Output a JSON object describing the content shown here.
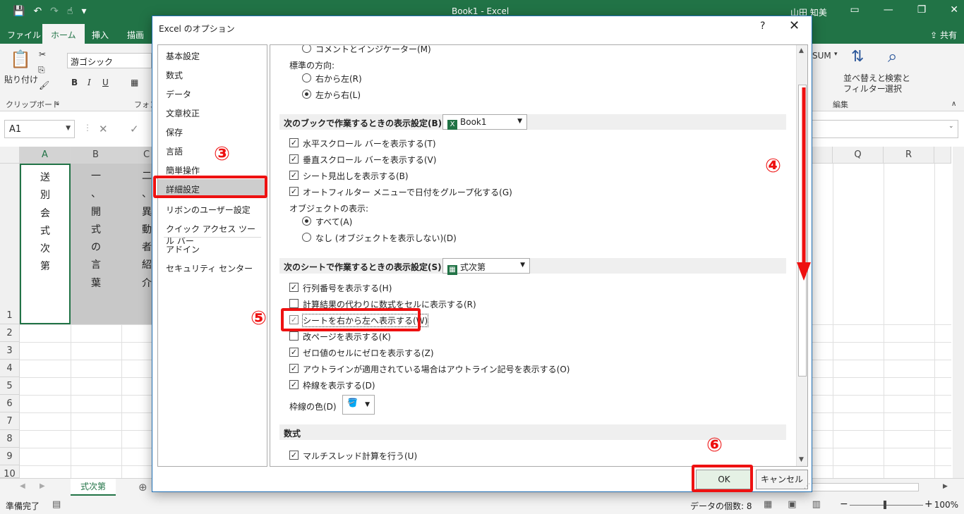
{
  "window": {
    "title": "Book1  -  Excel",
    "user": "山田 知美",
    "share_label": "共有"
  },
  "ribbon": {
    "tabs": [
      "ファイル",
      "ホーム",
      "挿入",
      "描画"
    ],
    "paste_label": "貼り付け",
    "clipboard_group": "クリップボード",
    "font_group": "フォン",
    "font_name": "游ゴシック",
    "bold": "B",
    "italic": "I",
    "underline": "U",
    "sum_label": "SUM",
    "sort_label": "並べ替えと\nフィルター",
    "find_label": "検索と\n選択",
    "edit_group": "編集"
  },
  "formula_bar": {
    "name_box": "A1",
    "cancel": "✕",
    "enter": "✓"
  },
  "grid": {
    "columns": [
      "A",
      "B",
      "C",
      "Q",
      "R"
    ],
    "rows": [
      "1",
      "2",
      "3",
      "4",
      "5",
      "6",
      "7",
      "8",
      "9",
      "10"
    ],
    "col_a_text": [
      "送",
      "別",
      "会",
      "式",
      "次",
      "第"
    ],
    "col_b_text": [
      "一",
      "、",
      "開",
      "式",
      "の",
      "言",
      "葉"
    ],
    "col_c_text": [
      "二",
      "、",
      "異",
      "動",
      "者",
      "紹",
      "介"
    ]
  },
  "sheet_tab": "式次第",
  "status": {
    "ready": "準備完了",
    "count": "データの個数: 8",
    "zoom": "100%"
  },
  "dialog": {
    "title": "Excel のオプション",
    "help": "?",
    "close": "✕",
    "nav": [
      "基本設定",
      "数式",
      "データ",
      "文章校正",
      "保存",
      "言語",
      "簡単操作",
      "詳細設定",
      "リボンのユーザー設定",
      "クイック アクセス ツール バー",
      "アドイン",
      "セキュリティ センター"
    ],
    "top": {
      "comment_indicator": "コメントとインジケーター(M)",
      "direction_label": "標準の方向:",
      "rtl": "右から左(R)",
      "ltr": "左から右(L)"
    },
    "book_section": {
      "title": "次のブックで作業するときの表示設定(B):",
      "combo": "Book1",
      "hscroll": "水平スクロール バーを表示する(T)",
      "vscroll": "垂直スクロール バーを表示する(V)",
      "sheet_tabs": "シート見出しを表示する(B)",
      "autofilter": "オートフィルター メニューで日付をグループ化する(G)",
      "objects_label": "オブジェクトの表示:",
      "all": "すべて(A)",
      "none": "なし (オブジェクトを表示しない)(D)"
    },
    "sheet_section": {
      "title": "次のシートで作業するときの表示設定(S):",
      "combo": "式次第",
      "headers": "行列番号を表示する(H)",
      "formulas": "計算結果の代わりに数式をセルに表示する(R)",
      "rtl_sheet": "シートを右から左へ表示する(W)",
      "page_breaks": "改ページを表示する(K)",
      "zero": "ゼロ値のセルにゼロを表示する(Z)",
      "outline": "アウトラインが適用されている場合はアウトライン記号を表示する(O)",
      "gridlines": "枠線を表示する(D)",
      "grid_color": "枠線の色(D)"
    },
    "formula_section": {
      "title": "数式",
      "multithread": "マルチスレッド計算を行う(U)"
    },
    "ok": "OK",
    "cancel": "キャンセル"
  },
  "annotations": {
    "step3": "③",
    "step4": "④",
    "step5": "⑤",
    "step6": "⑥",
    "color": "#ee1111"
  }
}
